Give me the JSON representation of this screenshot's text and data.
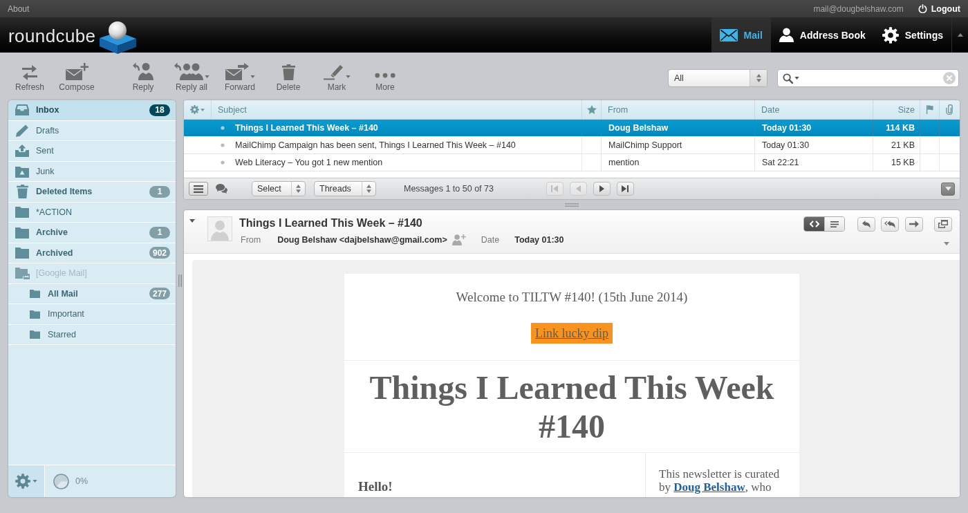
{
  "top_bar": {
    "about": "About",
    "user": "mail@dougbelshaw.com",
    "logout": "Logout"
  },
  "header": {
    "logo": "roundcube",
    "nav": [
      {
        "label": "Mail",
        "kind": "mail",
        "selected": true
      },
      {
        "label": "Address Book",
        "kind": "contacts",
        "selected": false
      },
      {
        "label": "Settings",
        "kind": "settings",
        "selected": false
      }
    ]
  },
  "toolbar": {
    "buttons": [
      {
        "label": "Refresh",
        "kind": "refresh",
        "dropdown": false
      },
      {
        "label": "Compose",
        "kind": "compose",
        "dropdown": false
      },
      {
        "label": "Reply",
        "kind": "reply",
        "dropdown": false
      },
      {
        "label": "Reply all",
        "kind": "reply-all",
        "dropdown": true
      },
      {
        "label": "Forward",
        "kind": "forward",
        "dropdown": true
      },
      {
        "label": "Delete",
        "kind": "delete",
        "dropdown": false
      },
      {
        "label": "Mark",
        "kind": "mark",
        "dropdown": true
      },
      {
        "label": "More",
        "kind": "more",
        "dropdown": false
      }
    ],
    "filter": {
      "value": "All"
    }
  },
  "folders": {
    "items": [
      {
        "name": "Inbox",
        "kind": "inbox",
        "count": "18",
        "selected": true,
        "disabled": false
      },
      {
        "name": "Drafts",
        "kind": "drafts",
        "selected": false,
        "disabled": false
      },
      {
        "name": "Sent",
        "kind": "sent",
        "selected": false,
        "disabled": false
      },
      {
        "name": "Junk",
        "kind": "junk",
        "selected": false,
        "disabled": false
      },
      {
        "name": "Deleted Items",
        "kind": "trash",
        "count": "1",
        "selected": false,
        "disabled": false
      },
      {
        "name": "*ACTION",
        "kind": "folder",
        "selected": false,
        "disabled": false
      },
      {
        "name": "Archive",
        "kind": "folder",
        "count": "1",
        "selected": false,
        "disabled": false
      },
      {
        "name": "Archived",
        "kind": "folder",
        "count": "902",
        "selected": false,
        "disabled": false
      },
      {
        "name": "[Google Mail]",
        "kind": "virtual",
        "selected": false,
        "disabled": true,
        "children": [
          {
            "name": "All Mail",
            "kind": "folder",
            "count": "277",
            "selected": false,
            "disabled": false
          },
          {
            "name": "Important",
            "kind": "folder",
            "selected": false,
            "disabled": false
          },
          {
            "name": "Starred",
            "kind": "folder",
            "selected": false,
            "disabled": false
          }
        ]
      }
    ],
    "quota": {
      "label": "0%"
    }
  },
  "message_list": {
    "columns": [
      {
        "kind": "options"
      },
      {
        "kind": "label",
        "label": "Subject"
      },
      {
        "kind": "star"
      },
      {
        "kind": "label",
        "label": "From"
      },
      {
        "kind": "label",
        "label": "Date"
      },
      {
        "kind": "label",
        "label": "Size"
      },
      {
        "kind": "flag"
      },
      {
        "kind": "attachment"
      }
    ],
    "rows": [
      {
        "subject": "Things I Learned This Week – #140",
        "from": "Doug Belshaw",
        "date": "Today 01:30",
        "size": "114 KB",
        "selected": true,
        "unread": true
      },
      {
        "subject": "MailChimp Campaign has been sent, Things I Learned This Week – #140",
        "from": "MailChimp Support",
        "date": "Today 01:30",
        "size": "21 KB",
        "selected": false,
        "unread": false
      },
      {
        "subject": "Web Literacy – You got 1 new mention",
        "from": "mention",
        "date": "Sat 22:21",
        "size": "15 KB",
        "selected": false,
        "unread": false
      }
    ],
    "footer": {
      "select": "Select",
      "threading": "Threads",
      "count": "Messages 1 to 50 of 73",
      "pager": [
        {
          "kind": "first",
          "disabled": true
        },
        {
          "kind": "prev",
          "disabled": true
        },
        {
          "kind": "next",
          "disabled": false
        },
        {
          "kind": "last",
          "disabled": false
        }
      ]
    }
  },
  "preview": {
    "subject": "Things I Learned This Week – #140",
    "from_label": "From",
    "from": "Doug Belshaw <dajbelshaw@gmail.com>",
    "date_label": "Date",
    "date": "Today 01:30",
    "view_modes": [
      {
        "kind": "html",
        "selected": true
      },
      {
        "kind": "plain",
        "selected": false
      }
    ],
    "actions": [
      {
        "kind": "reply"
      },
      {
        "kind": "reply-all"
      },
      {
        "kind": "forward"
      },
      {
        "kind": "new-window"
      }
    ],
    "email": {
      "intro": "Welcome to TILTW #140! (15th June 2014)",
      "button": "Link lucky dip",
      "heading": "Things I Learned This Week #140",
      "greeting": "Hello!",
      "note": {
        "before": "This newsletter is curated by ",
        "link": "Doug Belshaw",
        "after": ", who"
      }
    }
  }
}
